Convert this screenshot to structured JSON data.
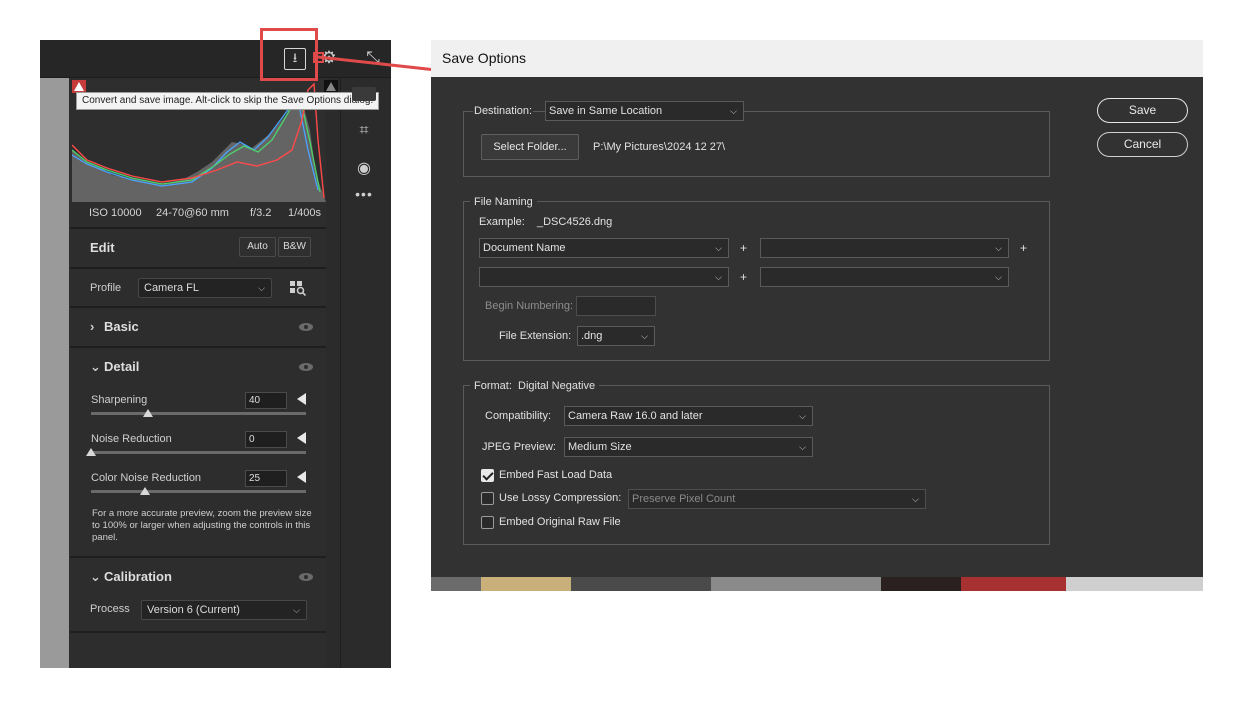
{
  "left_panel": {
    "tooltip": "Convert and save image.  Alt-click to skip the Save Options dialog.",
    "icons": {
      "save": "save-download-icon",
      "settings": "gear-icon",
      "collapse": "shrink-icon"
    },
    "exif": {
      "iso": "ISO 10000",
      "lens": "24-70@60 mm",
      "aperture": "f/3.2",
      "shutter": "1/400s"
    },
    "edit": {
      "title": "Edit",
      "auto_label": "Auto",
      "bw_label": "B&W"
    },
    "profile": {
      "label": "Profile",
      "value": "Camera FL"
    },
    "basic": {
      "title": "Basic"
    },
    "detail": {
      "title": "Detail",
      "sliders": [
        {
          "label": "Sharpening",
          "value": "40",
          "level": 40,
          "max": 150
        },
        {
          "label": "Noise Reduction",
          "value": "0",
          "level": 0,
          "max": 100
        },
        {
          "label": "Color Noise Reduction",
          "value": "25",
          "level": 25,
          "max": 100
        }
      ],
      "note": "For a more accurate preview, zoom the preview size to 100% or larger when adjusting the controls in this panel."
    },
    "calibration": {
      "title": "Calibration",
      "process_label": "Process",
      "process_value": "Version 6 (Current)"
    },
    "colors": {
      "highlight": "#e14a4a"
    }
  },
  "dialog": {
    "title": "Save Options",
    "save_label": "Save",
    "cancel_label": "Cancel",
    "destination": {
      "label": "Destination:",
      "value": "Save in Same Location",
      "select_folder_label": "Select Folder...",
      "path": "P:\\My Pictures\\2024 12 27\\"
    },
    "file_naming": {
      "legend": "File Naming",
      "example_label": "Example:",
      "example_value": "_DSC4526.dng",
      "field1": "Document Name",
      "field2": "",
      "field3": "",
      "field4": "",
      "plus": "+",
      "begin_numbering_label": "Begin Numbering:",
      "file_extension_label": "File Extension:",
      "file_extension_value": ".dng"
    },
    "format": {
      "legend_label": "Format:",
      "legend_value": "Digital Negative",
      "compatibility_label": "Compatibility:",
      "compatibility_value": "Camera Raw 16.0 and later",
      "jpeg_preview_label": "JPEG Preview:",
      "jpeg_preview_value": "Medium Size",
      "embed_fast_load": {
        "label": "Embed Fast Load Data",
        "checked": true
      },
      "lossy": {
        "label": "Use Lossy Compression:",
        "checked": false,
        "value": "Preserve Pixel Count"
      },
      "embed_raw": {
        "label": "Embed Original Raw File",
        "checked": false
      }
    }
  }
}
